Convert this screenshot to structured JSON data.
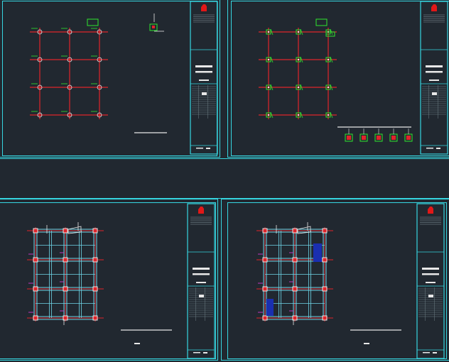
{
  "viewer": {
    "background": "#212830"
  },
  "colors": {
    "frame": "#36d6e0",
    "grid_line": "#e0242a",
    "column_green": "#2ee62e",
    "beam_cyan": "#6fd6e8",
    "white_line": "#e8e8e8",
    "magenta": "#d23cd2",
    "blue_fill": "#1a2fb0",
    "logo_red": "#e01818"
  },
  "sheets": [
    {
      "name": "column-layout-plan",
      "grid_cols": 3,
      "grid_rows": 4
    },
    {
      "name": "column-detail-plan",
      "grid_cols": 3,
      "grid_rows": 4,
      "detail_markers": 5
    },
    {
      "name": "beam-framing-plan-1",
      "grid_cols": 3,
      "grid_rows": 4
    },
    {
      "name": "beam-framing-plan-2",
      "grid_cols": 3,
      "grid_rows": 4
    }
  ]
}
